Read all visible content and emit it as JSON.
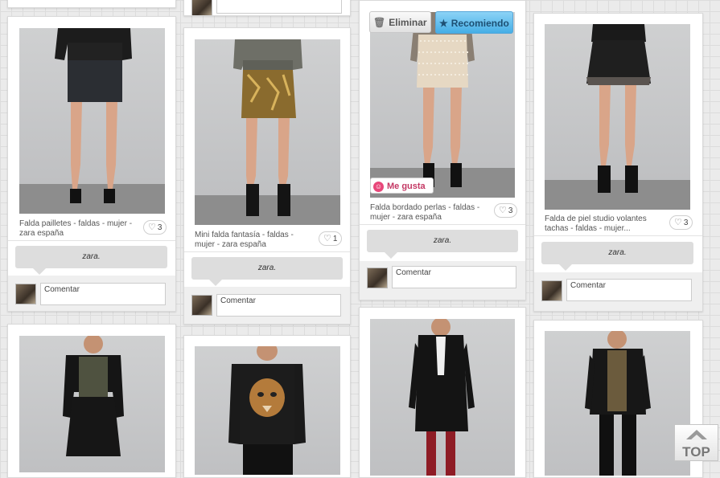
{
  "overlay": {
    "delete_label": "Eliminar",
    "recommend_label": "Recomiendo",
    "like_label": "Me gusta"
  },
  "pins": [
    {
      "desc": "Falda pailletes - faldas - mujer - zara españa",
      "likes": "3",
      "comment": "zara.",
      "placeholder": "Comentar"
    },
    {
      "desc": "Mini falda fantasía - faldas - mujer - zara españa",
      "likes": "1",
      "comment": "zara.",
      "placeholder": "Comentar"
    },
    {
      "desc": "Falda bordado perlas - faldas - mujer - zara españa",
      "likes": "3",
      "comment": "zara.",
      "placeholder": "Comentar"
    },
    {
      "desc": "Falda de piel studio volantes tachas - faldas - mujer...",
      "likes": "3",
      "comment": "zara.",
      "placeholder": "Comentar"
    }
  ],
  "top_button": {
    "label": "TOP"
  },
  "colors": {
    "accent_blue": "#45aee6",
    "like_pink": "#e8477a",
    "background": "#ebebeb"
  }
}
